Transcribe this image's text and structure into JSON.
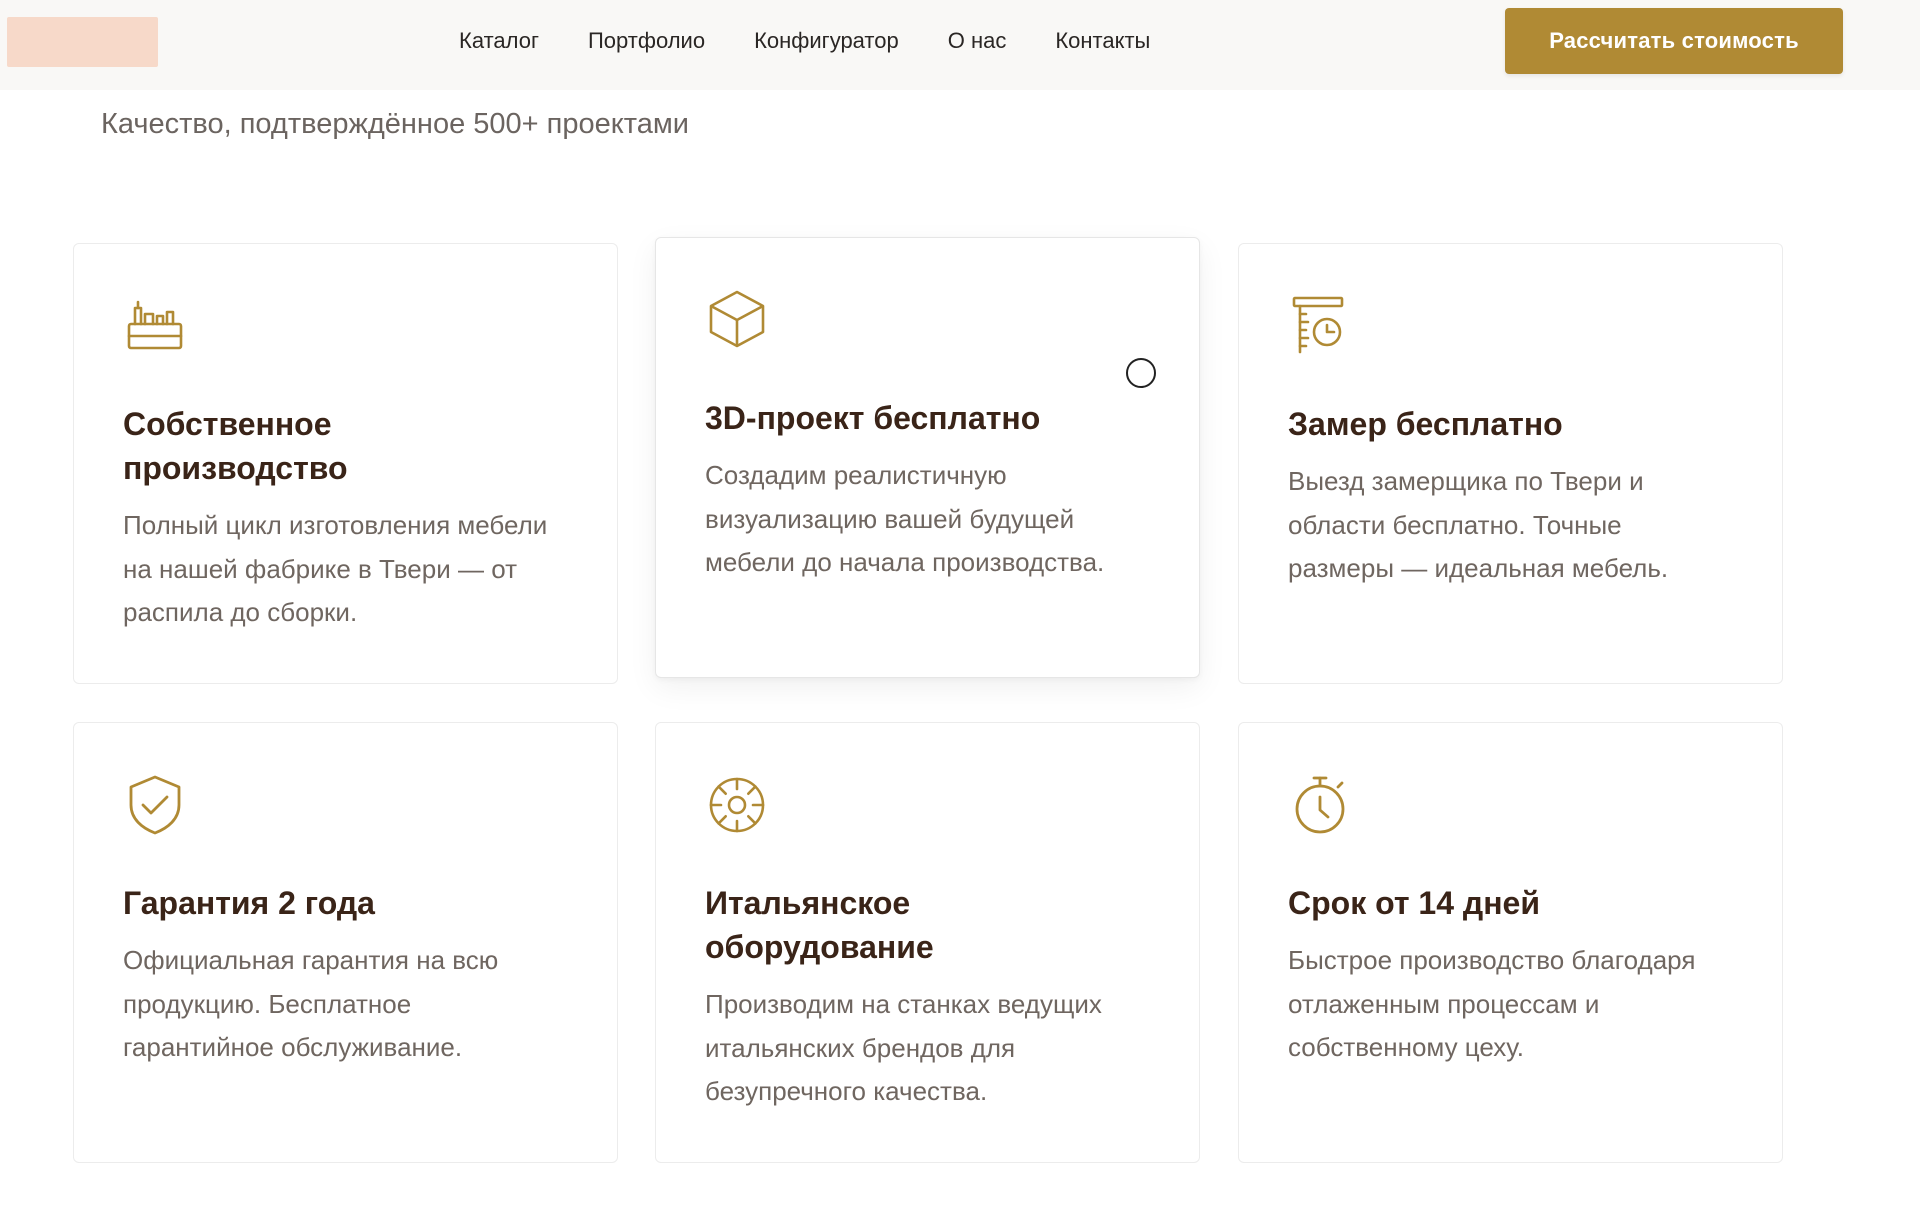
{
  "header": {
    "nav": [
      "Каталог",
      "Портфолио",
      "Конфигуратор",
      "О нас",
      "Контакты"
    ],
    "cta_label": "Рассчитать стоимость"
  },
  "section": {
    "subtitle": "Качество, подтверждённое 500+ проектами"
  },
  "accent_color": "#b08a34",
  "features": [
    {
      "icon": "factory-icon",
      "title": "Собственное производство",
      "text": "Полный цикл изготовления мебели на нашей фабрике в Твери — от распила до сборки."
    },
    {
      "icon": "cube-icon",
      "title": "3D-проект бесплатно",
      "text": "Создадим реалистичную визуализацию вашей будущей мебели до начала производства."
    },
    {
      "icon": "ruler-clock-icon",
      "title": "Замер бесплатно",
      "text": "Выезд замерщика по Твери и области бесплатно. Точные размеры — идеальная мебель."
    },
    {
      "icon": "shield-check-icon",
      "title": "Гарантия 2 года",
      "text": "Официальная гарантия на всю продукцию. Бесплатное гарантийное обслуживание."
    },
    {
      "icon": "gear-icon",
      "title": "Итальянское оборудование",
      "text": "Производим на станках ведущих итальянских брендов для безупречного качества."
    },
    {
      "icon": "stopwatch-icon",
      "title": "Срок от 14 дней",
      "text": "Быстрое производство благодаря отлаженным процессам и собственному цеху."
    }
  ]
}
